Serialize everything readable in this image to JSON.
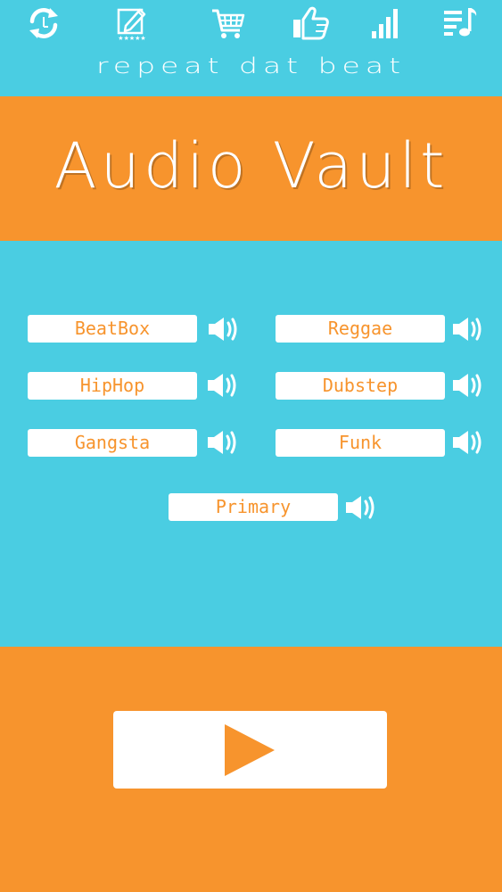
{
  "header": {
    "tagline": "repeat dat beat",
    "icons": [
      {
        "name": "refresh-icon"
      },
      {
        "name": "rate-icon"
      },
      {
        "name": "cart-icon"
      },
      {
        "name": "thumbs-up-icon"
      },
      {
        "name": "signal-bars-icon"
      },
      {
        "name": "playlist-icon"
      }
    ]
  },
  "banner": {
    "title": "Audio Vault"
  },
  "sounds": {
    "beatbox": "BeatBox",
    "reggae": "Reggae",
    "hiphop": "HipHop",
    "dubstep": "Dubstep",
    "gangsta": "Gangsta",
    "funk": "Funk",
    "primary": "Primary"
  },
  "player": {
    "play_icon": "play-icon"
  },
  "colors": {
    "cyan": "#4acde2",
    "orange": "#f7942d",
    "white": "#ffffff"
  }
}
